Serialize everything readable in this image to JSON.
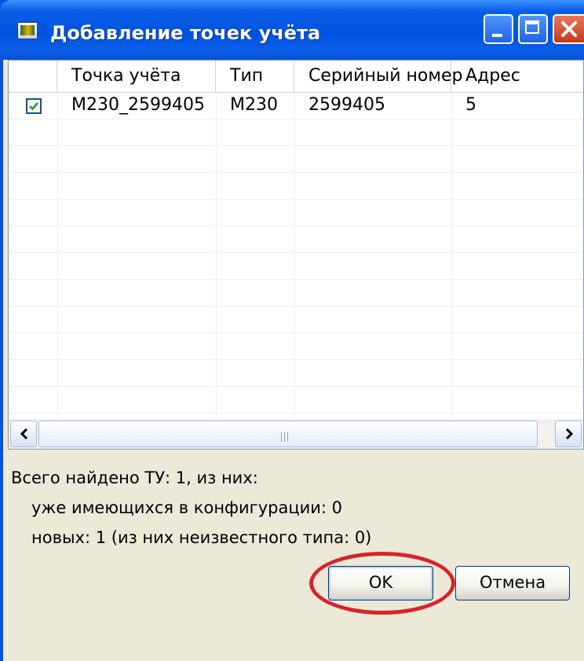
{
  "window": {
    "title": "Добавление точек учёта"
  },
  "table": {
    "columns": [
      "Точка учёта",
      "Тип",
      "Серийный номер",
      "Адрес"
    ],
    "rows": [
      {
        "checked": true,
        "point": "М230_2599405",
        "type": "М230",
        "serial": "2599405",
        "address": "5"
      }
    ]
  },
  "summary": {
    "total": "Всего найдено ТУ: 1, из них:",
    "existing": "уже имеющихся в конфигурации: 0",
    "new": "новых: 1 (из них неизвестного типа: 0)"
  },
  "buttons": {
    "ok": "OK",
    "cancel": "Отмена"
  },
  "colors": {
    "titlebar": "#0054e3",
    "highlight": "#d8232a",
    "frame": "#ece9d8"
  }
}
